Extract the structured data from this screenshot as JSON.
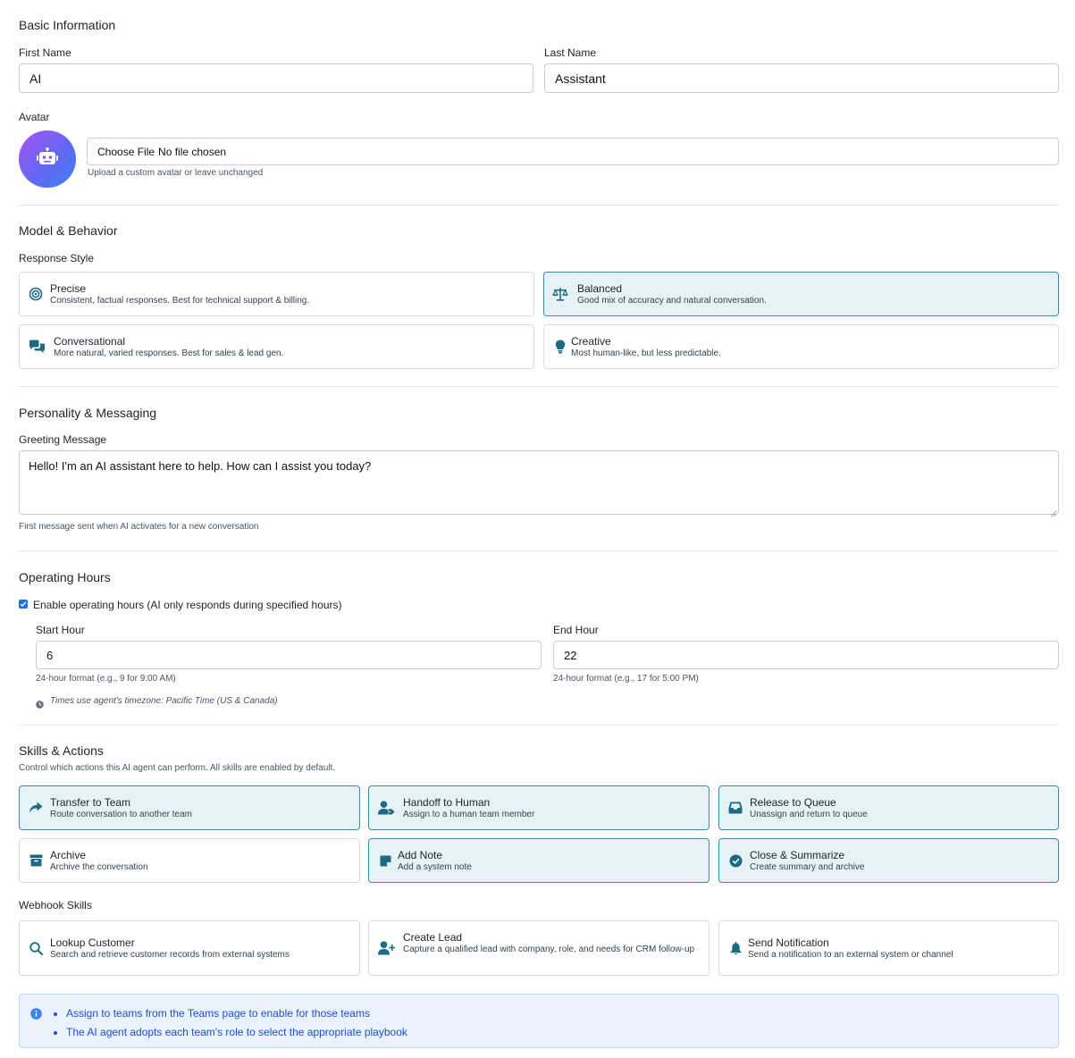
{
  "colors": {
    "accent": "#1d6a84",
    "selected_bg": "#e5f3f7",
    "selected_border": "#3d8aa8",
    "info_text": "#1d4ed8",
    "avatar_gradient": [
      "#a855f7",
      "#3b82f6"
    ]
  },
  "basic": {
    "title": "Basic Information",
    "first_name_label": "First Name",
    "first_name_value": "AI",
    "last_name_label": "Last Name",
    "last_name_value": "Assistant",
    "avatar_label": "Avatar",
    "avatar_icon": "robot-icon",
    "file_button": "Choose File",
    "file_status": "No file chosen",
    "avatar_help": "Upload a custom avatar or leave unchanged"
  },
  "model": {
    "title": "Model & Behavior",
    "response_style_label": "Response Style",
    "options": [
      {
        "title": "Precise",
        "desc": "Consistent, factual responses. Best for technical support & billing.",
        "icon": "target-icon",
        "selected": false
      },
      {
        "title": "Balanced",
        "desc": "Good mix of accuracy and natural conversation.",
        "icon": "scale-icon",
        "selected": true
      },
      {
        "title": "Conversational",
        "desc": "More natural, varied responses. Best for sales & lead gen.",
        "icon": "chat-bubbles-icon",
        "selected": false
      },
      {
        "title": "Creative",
        "desc": "Most human-like, but less predictable.",
        "icon": "lightbulb-icon",
        "selected": false
      }
    ]
  },
  "personality": {
    "title": "Personality & Messaging",
    "greeting_label": "Greeting Message",
    "greeting_value": "Hello! I'm an AI assistant here to help. How can I assist you today?",
    "greeting_help": "First message sent when AI activates for a new conversation"
  },
  "hours": {
    "title": "Operating Hours",
    "enable_label": "Enable operating hours (AI only responds during specified hours)",
    "enabled": true,
    "start_label": "Start Hour",
    "start_value": "6",
    "start_help": "24-hour format (e.g., 9 for 9:00 AM)",
    "end_label": "End Hour",
    "end_value": "22",
    "end_help": "24-hour format (e.g., 17 for 5:00 PM)",
    "timezone_note": "Times use agent's timezone: Pacific Time (US & Canada)"
  },
  "skills": {
    "title": "Skills & Actions",
    "subtitle": "Control which actions this AI agent can perform. All skills are enabled by default.",
    "items": [
      {
        "title": "Transfer to Team",
        "desc": "Route conversation to another team",
        "icon": "share-arrow-icon",
        "selected": true
      },
      {
        "title": "Handoff to Human",
        "desc": "Assign to a human team member",
        "icon": "user-tag-icon",
        "selected": true
      },
      {
        "title": "Release to Queue",
        "desc": "Unassign and return to queue",
        "icon": "inbox-icon",
        "selected": true
      },
      {
        "title": "Archive",
        "desc": "Archive the conversation",
        "icon": "archive-box-icon",
        "selected": false
      },
      {
        "title": "Add Note",
        "desc": "Add a system note",
        "icon": "sticky-note-icon",
        "selected": true
      },
      {
        "title": "Close & Summarize",
        "desc": "Create summary and archive",
        "icon": "check-circle-icon",
        "selected": true
      }
    ],
    "webhook_label": "Webhook Skills",
    "webhooks": [
      {
        "title": "Lookup Customer",
        "desc": "Search and retrieve customer records from external systems",
        "icon": "search-icon",
        "selected": false
      },
      {
        "title": "Create Lead",
        "desc": "Capture a qualified lead with company, role, and needs for CRM follow-up",
        "icon": "user-plus-icon",
        "selected": false
      },
      {
        "title": "Send Notification",
        "desc": "Send a notification to an external system or channel",
        "icon": "bell-icon",
        "selected": false
      }
    ]
  },
  "info": {
    "icon": "info-circle-icon",
    "items": [
      "Assign to teams from the Teams page to enable for those teams",
      "The AI agent adopts each team's role to select the appropriate playbook"
    ]
  }
}
